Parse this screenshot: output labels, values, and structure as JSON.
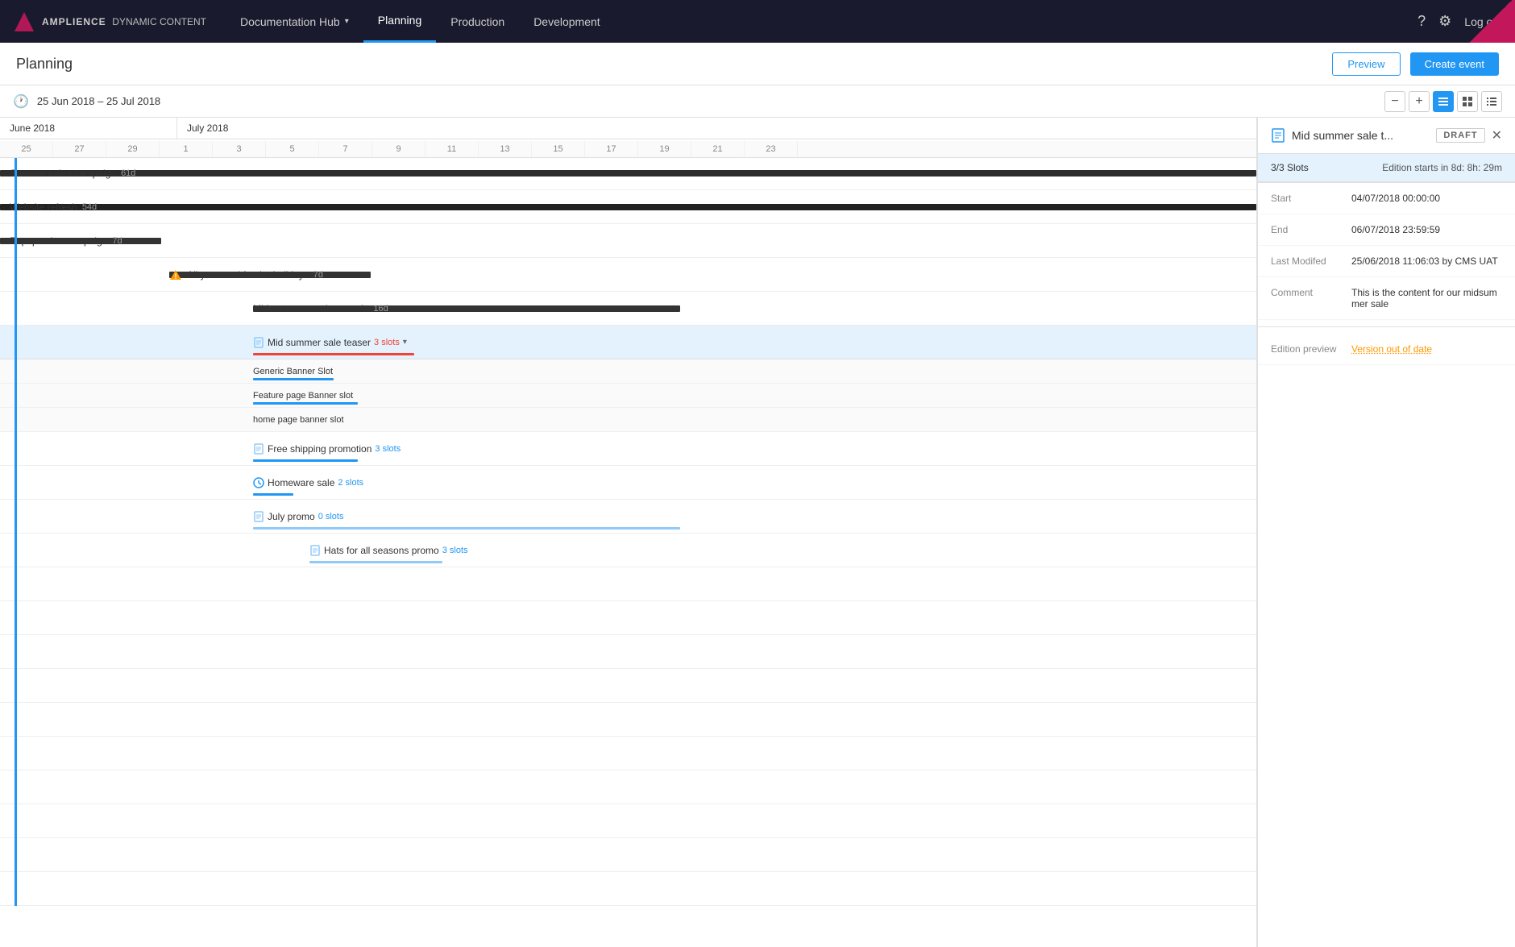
{
  "brand": {
    "name_prefix": "AMPLIENCE",
    "name_suffix": "DYNAMIC CONTENT"
  },
  "nav": {
    "tabs": [
      {
        "id": "documentation-hub",
        "label": "Documentation Hub",
        "active": false,
        "has_dropdown": true
      },
      {
        "id": "planning",
        "label": "Planning",
        "active": true,
        "has_dropdown": false
      },
      {
        "id": "production",
        "label": "Production",
        "active": false,
        "has_dropdown": false
      },
      {
        "id": "development",
        "label": "Development",
        "active": false,
        "has_dropdown": false
      }
    ],
    "logout_label": "Log out"
  },
  "page": {
    "title": "Planning",
    "preview_btn": "Preview",
    "create_btn": "Create event"
  },
  "date_range": {
    "label": "25 Jun 2018 – 25 Jul 2018"
  },
  "calendar": {
    "months": [
      {
        "label": "June 2018"
      },
      {
        "label": "July 2018"
      }
    ],
    "days": [
      25,
      27,
      29,
      1,
      3,
      5,
      7,
      9,
      11,
      13,
      15,
      17,
      19,
      21,
      23
    ]
  },
  "events": [
    {
      "id": "summer-sales",
      "label": "Summer sales campaign",
      "duration": "61d"
    },
    {
      "id": "website-refresh",
      "label": "Website refresh",
      "duration": "54d"
    },
    {
      "id": "popup-sales",
      "label": "Popup sales campaign",
      "duration": "7d"
    },
    {
      "id": "holidays",
      "label": "All you need for the holidays",
      "duration": "7d",
      "warning": true
    },
    {
      "id": "mid-summer-madness",
      "label": "Mid summer madness sale",
      "duration": "16d"
    },
    {
      "id": "mid-summer-teaser",
      "label": "Mid summer sale teaser",
      "slots": "3 slots",
      "highlighted": true
    },
    {
      "id": "generic-banner",
      "label": "Generic Banner Slot",
      "is_slot": true
    },
    {
      "id": "feature-page",
      "label": "Feature page Banner slot",
      "is_slot": true
    },
    {
      "id": "home-page",
      "label": "home page banner slot",
      "is_slot": true
    },
    {
      "id": "free-shipping",
      "label": "Free shipping promotion",
      "slots": "3 slots"
    },
    {
      "id": "homeware-sale",
      "label": "Homeware sale",
      "slots": "2 slots",
      "type": "scheduled"
    },
    {
      "id": "july-promo",
      "label": "July promo",
      "slots": "0 slots"
    },
    {
      "id": "hats-promo",
      "label": "Hats for all seasons promo",
      "slots": "3 slots"
    }
  ],
  "right_panel": {
    "title": "Mid summer sale t...",
    "status": "DRAFT",
    "slots_label": "3/3 Slots",
    "edition_starts": "Edition starts in 8d: 8h: 29m",
    "fields": [
      {
        "label": "Start",
        "value": "04/07/2018 00:00:00"
      },
      {
        "label": "End",
        "value": "06/07/2018 23:59:59"
      },
      {
        "label": "Last Modifed",
        "value": "25/06/2018 11:06:03 by CMS UAT"
      },
      {
        "label": "Comment",
        "value": "This is the content for our midsum mer sale"
      },
      {
        "label": "Edition preview",
        "value": "Version out of date",
        "is_link": true
      }
    ]
  }
}
